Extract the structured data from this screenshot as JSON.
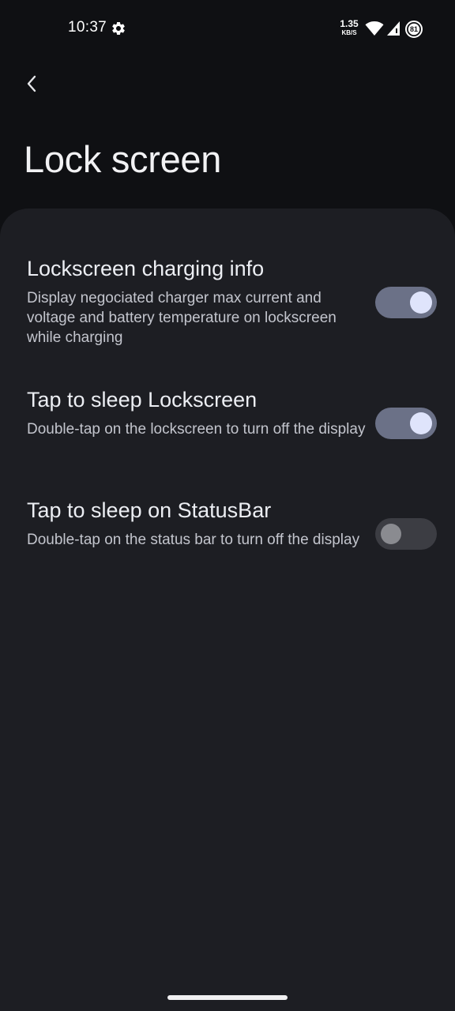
{
  "status_bar": {
    "time": "10:37",
    "net_speed_value": "1.35",
    "net_speed_unit": "KB/S",
    "battery_level": "81",
    "icons": [
      "gear-icon",
      "wifi-icon",
      "signal-icon",
      "battery-icon"
    ]
  },
  "header": {
    "back_icon": "chevron-left-icon",
    "title": "Lock screen"
  },
  "preferences": [
    {
      "title": "Lockscreen charging info",
      "summary": "Display negociated charger max current and voltage and battery temperature on lockscreen while charging",
      "enabled": true
    },
    {
      "title": "Tap to sleep Lockscreen",
      "summary": "Double-tap on the lockscreen to turn off the display",
      "enabled": true
    },
    {
      "title": "Tap to sleep on StatusBar",
      "summary": "Double-tap on the status bar to turn off the display",
      "enabled": false
    }
  ],
  "colors": {
    "background": "#0f1013",
    "panel": "#1d1e23",
    "switch_on_track": "#6b7187",
    "switch_on_thumb": "#dfe4fb",
    "switch_off_track": "#3c3d43",
    "switch_off_thumb": "#8a8b90"
  }
}
